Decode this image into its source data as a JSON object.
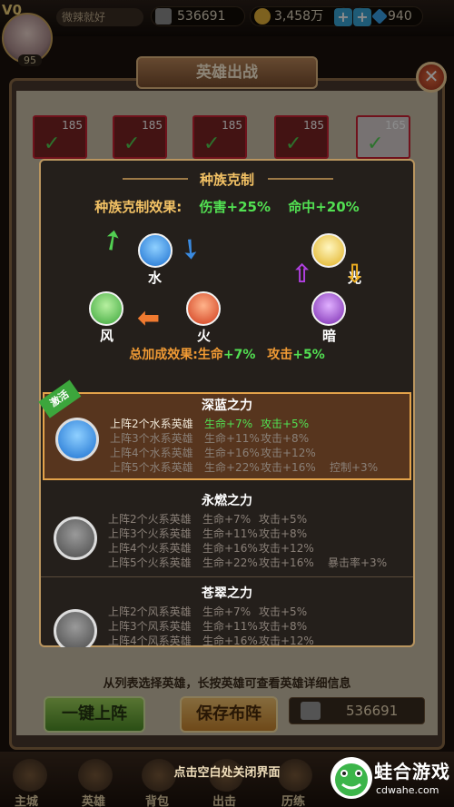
{
  "topbar": {
    "vip": "V0",
    "level": "95",
    "player_name": "微辣就好",
    "power": "536691",
    "coins": "3,458万",
    "gems": "940"
  },
  "panel": {
    "title": "英雄出战",
    "heroes": [
      {
        "level": "185"
      },
      {
        "level": "185"
      },
      {
        "level": "185"
      },
      {
        "level": "185"
      },
      {
        "level": "165"
      }
    ],
    "hint": "从列表选择英雄，长按英雄可查看英雄详细信息",
    "one_click_label": "一键上阵",
    "save_label": "保存布阵",
    "power_value": "536691"
  },
  "nav": {
    "close_hint": "点击空白处关闭界面",
    "items": [
      "主城",
      "英雄",
      "背包",
      "出击",
      "历练"
    ],
    "logo_text": "蛙合游戏",
    "logo_sub": "cdwahe.com"
  },
  "dialog": {
    "title": "种族克制",
    "effect_label": "种族克制效果:",
    "effect_damage": "伤害+25%",
    "effect_hit": "命中+20%",
    "races": {
      "water": "水",
      "fire": "火",
      "wind": "风",
      "light": "光",
      "dark": "暗"
    },
    "total_label": "总加成效果:生命",
    "total_hp": "+7%",
    "total_atk_label": "攻击",
    "total_atk": "+5%",
    "active_badge": "激活",
    "sections": [
      {
        "title": "深蓝之力",
        "lines": [
          {
            "cond": "上阵2个水系英雄",
            "hp": "生命+7%",
            "atk": "攻击+5%",
            "extra": ""
          },
          {
            "cond": "上阵3个水系英雄",
            "hp": "生命+11%",
            "atk": "攻击+8%",
            "extra": ""
          },
          {
            "cond": "上阵4个水系英雄",
            "hp": "生命+16%",
            "atk": "攻击+12%",
            "extra": ""
          },
          {
            "cond": "上阵5个水系英雄",
            "hp": "生命+22%",
            "atk": "攻击+16%",
            "extra": "控制+3%"
          }
        ]
      },
      {
        "title": "永燃之力",
        "lines": [
          {
            "cond": "上阵2个火系英雄",
            "hp": "生命+7%",
            "atk": "攻击+5%",
            "extra": ""
          },
          {
            "cond": "上阵3个火系英雄",
            "hp": "生命+11%",
            "atk": "攻击+8%",
            "extra": ""
          },
          {
            "cond": "上阵4个火系英雄",
            "hp": "生命+16%",
            "atk": "攻击+12%",
            "extra": ""
          },
          {
            "cond": "上阵5个火系英雄",
            "hp": "生命+22%",
            "atk": "攻击+16%",
            "extra": "暴击率+3%"
          }
        ]
      },
      {
        "title": "苍翠之力",
        "lines": [
          {
            "cond": "上阵2个风系英雄",
            "hp": "生命+7%",
            "atk": "攻击+5%",
            "extra": ""
          },
          {
            "cond": "上阵3个风系英雄",
            "hp": "生命+11%",
            "atk": "攻击+8%",
            "extra": ""
          },
          {
            "cond": "上阵4个风系英雄",
            "hp": "生命+16%",
            "atk": "攻击+12%",
            "extra": ""
          }
        ]
      }
    ]
  },
  "colors": {
    "active_green": "#52e052",
    "inactive_gray": "#8a8078",
    "accent_gold": "#f3c265",
    "title_orange": "#f09a34"
  }
}
